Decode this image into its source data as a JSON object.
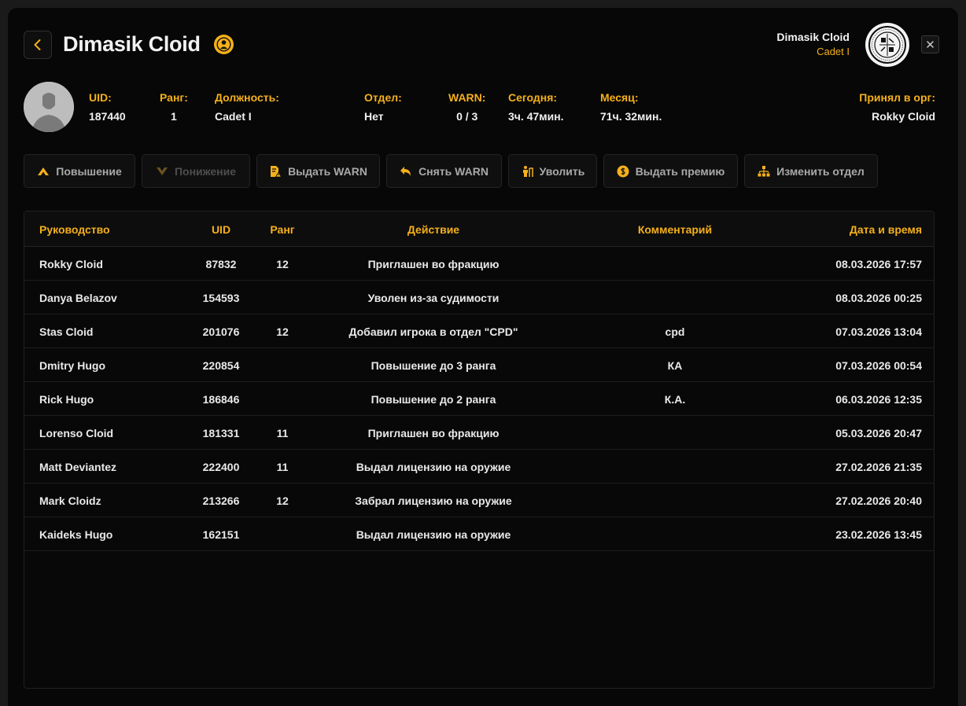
{
  "header": {
    "title": "Dimasik Cloid",
    "user_name": "Dimasik Cloid",
    "user_rank": "Cadet I"
  },
  "profile": {
    "stats": [
      {
        "label": "UID:",
        "value": "187440"
      },
      {
        "label": "Ранг:",
        "value": "1"
      },
      {
        "label": "Должность:",
        "value": "Cadet I"
      },
      {
        "label": "Отдел:",
        "value": "Нет"
      },
      {
        "label": "WARN:",
        "value": "0 / 3"
      },
      {
        "label": "Сегодня:",
        "value": "3ч. 47мин."
      },
      {
        "label": "Месяц:",
        "value": "71ч. 32мин."
      },
      {
        "label": "Принял в орг:",
        "value": "Rokky Cloid"
      }
    ]
  },
  "actions": [
    {
      "label": "Повышение",
      "icon": "chevron-up-icon",
      "enabled": true
    },
    {
      "label": "Понижение",
      "icon": "chevron-down-icon",
      "enabled": false
    },
    {
      "label": "Выдать WARN",
      "icon": "warn-document-icon",
      "enabled": true
    },
    {
      "label": "Снять WARN",
      "icon": "undo-arrow-icon",
      "enabled": true
    },
    {
      "label": "Уволить",
      "icon": "dismiss-person-icon",
      "enabled": true
    },
    {
      "label": "Выдать премию",
      "icon": "coin-icon",
      "enabled": true
    },
    {
      "label": "Изменить отдел",
      "icon": "hierarchy-icon",
      "enabled": true
    }
  ],
  "table": {
    "columns": [
      "Руководство",
      "UID",
      "Ранг",
      "Действие",
      "Комментарий",
      "Дата и время"
    ],
    "rows": [
      {
        "leader": "Rokky Cloid",
        "uid": "87832",
        "rank": "12",
        "action": "Приглашен во фракцию",
        "comment": "",
        "datetime": "08.03.2026 17:57"
      },
      {
        "leader": "Danya Belazov",
        "uid": "154593",
        "rank": "",
        "action": "Уволен из-за судимости",
        "comment": "",
        "datetime": "08.03.2026 00:25"
      },
      {
        "leader": "Stas Cloid",
        "uid": "201076",
        "rank": "12",
        "action": "Добавил игрока в отдел \"CPD\"",
        "comment": "cpd",
        "datetime": "07.03.2026 13:04"
      },
      {
        "leader": "Dmitry Hugo",
        "uid": "220854",
        "rank": "",
        "action": "Повышение до 3 ранга",
        "comment": "КА",
        "datetime": "07.03.2026 00:54"
      },
      {
        "leader": "Rick Hugo",
        "uid": "186846",
        "rank": "",
        "action": "Повышение до 2 ранга",
        "comment": "К.А.",
        "datetime": "06.03.2026 12:35"
      },
      {
        "leader": "Lorenso Cloid",
        "uid": "181331",
        "rank": "11",
        "action": "Приглашен во фракцию",
        "comment": "",
        "datetime": "05.03.2026 20:47"
      },
      {
        "leader": "Matt Deviantez",
        "uid": "222400",
        "rank": "11",
        "action": "Выдал лицензию на оружие",
        "comment": "",
        "datetime": "27.02.2026 21:35"
      },
      {
        "leader": "Mark Cloidz",
        "uid": "213266",
        "rank": "12",
        "action": "Забрал лицензию на оружие",
        "comment": "",
        "datetime": "27.02.2026 20:40"
      },
      {
        "leader": "Kaideks Hugo",
        "uid": "162151",
        "rank": "",
        "action": "Выдал лицензию на оружие",
        "comment": "",
        "datetime": "23.02.2026 13:45"
      }
    ]
  },
  "colors": {
    "accent": "#f5b01a",
    "background": "#070707",
    "text": "#e9e9e9",
    "muted": "#a9a9a9"
  }
}
